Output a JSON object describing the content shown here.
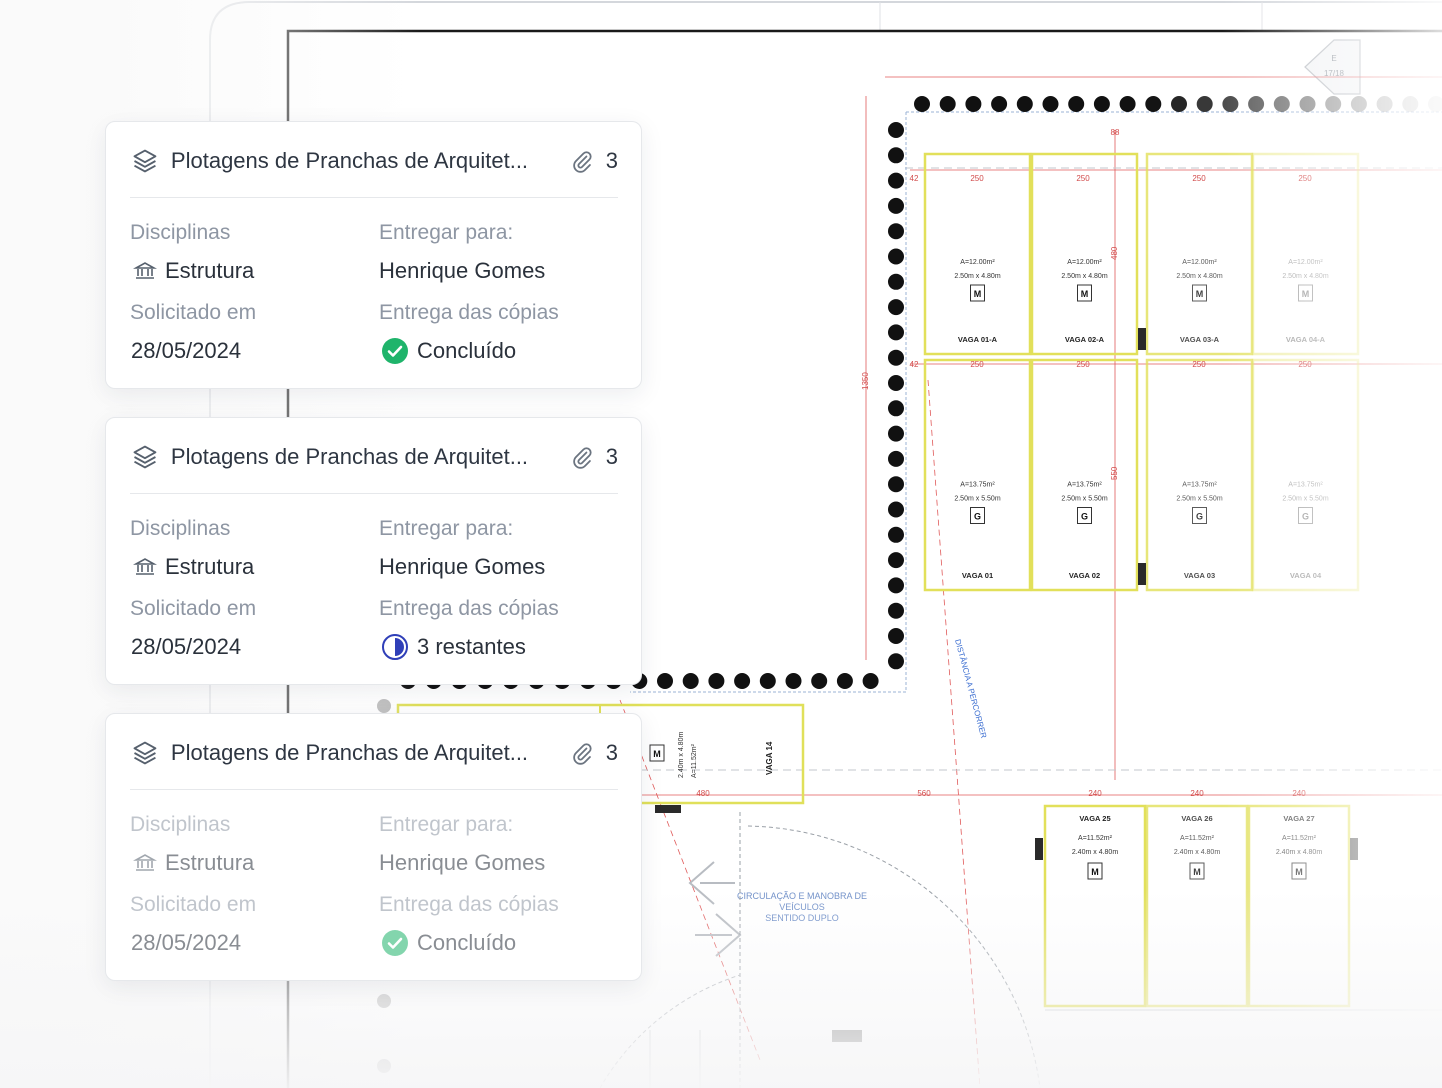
{
  "cards": [
    {
      "title": "Plotagens de Pranchas de Arquitet...",
      "attachment_count": "3",
      "disciplinas_label": "Disciplinas",
      "disciplina": "Estrutura",
      "entregar_label": "Entregar para:",
      "entregar_para": "Henrique Gomes",
      "solicitado_label": "Solicitado em",
      "solicitado_em": "28/05/2024",
      "entrega_label": "Entrega das cópias",
      "entrega_status": "Concluído",
      "status_icon": "check-circle-icon",
      "status_color": "#1fb46b"
    },
    {
      "title": "Plotagens de Pranchas de Arquitet...",
      "attachment_count": "3",
      "disciplinas_label": "Disciplinas",
      "disciplina": "Estrutura",
      "entregar_label": "Entregar para:",
      "entregar_para": "Henrique Gomes",
      "solicitado_label": "Solicitado em",
      "solicitado_em": "28/05/2024",
      "entrega_label": "Entrega das cópias",
      "entrega_status": "3 restantes",
      "status_icon": "half-circle-icon",
      "status_color": "#2f3fb8"
    },
    {
      "title": "Plotagens de Pranchas de Arquitet...",
      "attachment_count": "3",
      "disciplinas_label": "Disciplinas",
      "disciplina": "Estrutura",
      "entregar_label": "Entregar para:",
      "entregar_para": "Henrique Gomes",
      "solicitado_label": "Solicitado em",
      "solicitado_em": "28/05/2024",
      "entrega_label": "Entrega das cópias",
      "entrega_status": "Concluído",
      "status_icon": "check-circle-icon",
      "status_color": "#1fb46b"
    }
  ],
  "plan": {
    "spots_top": [
      {
        "name": "VAGA 01-A",
        "area": "A=12.00m²",
        "dims": "2.50m x 4.80m",
        "type": "M"
      },
      {
        "name": "VAGA 02-A",
        "area": "A=12.00m²",
        "dims": "2.50m x 4.80m",
        "type": "M"
      },
      {
        "name": "VAGA 03-A",
        "area": "A=12.00m²",
        "dims": "2.50m x 4.80m",
        "type": "M"
      },
      {
        "name": "VAGA 04-A",
        "area": "A=12.00m²",
        "dims": "2.50m x 4.80m",
        "type": "M"
      }
    ],
    "spots_mid": [
      {
        "name": "VAGA 01",
        "area": "A=13.75m²",
        "dims": "2.50m x 5.50m",
        "type": "G"
      },
      {
        "name": "VAGA 02",
        "area": "A=13.75m²",
        "dims": "2.50m x 5.50m",
        "type": "G"
      },
      {
        "name": "VAGA 03",
        "area": "A=13.75m²",
        "dims": "2.50m x 5.50m",
        "type": "G"
      },
      {
        "name": "VAGA 04",
        "area": "A=13.75m²",
        "dims": "2.50m x 5.50m",
        "type": "G"
      }
    ],
    "spots_bottom": [
      {
        "name": "VAGA 25",
        "area": "A=11.52m²",
        "dims": "2.40m x 4.80m",
        "type": "M"
      },
      {
        "name": "VAGA 26",
        "area": "A=11.52m²",
        "dims": "2.40m x 4.80m",
        "type": "M"
      },
      {
        "name": "VAGA 27",
        "area": "A=11.52m²",
        "dims": "2.40m x 4.80m",
        "type": "M"
      }
    ],
    "vaga14": {
      "name": "VAGA 14",
      "area": "A=11.52m²",
      "dims": "2.40m x 4.80m",
      "type": "M"
    },
    "circulation": [
      "CIRCULAÇÃO E MANOBRA DE",
      "VEÍCULOS",
      "SENTIDO DUPLO"
    ],
    "distance_label": "DISTÂNCIA A PERCORRER",
    "dims": {
      "d250": "250",
      "d480": "480",
      "d550": "550",
      "d560": "560",
      "d240": "240",
      "d1350": "1350",
      "d88": "88",
      "d42": "42"
    },
    "marker": {
      "letter": "E",
      "sheet": "17/18"
    }
  }
}
